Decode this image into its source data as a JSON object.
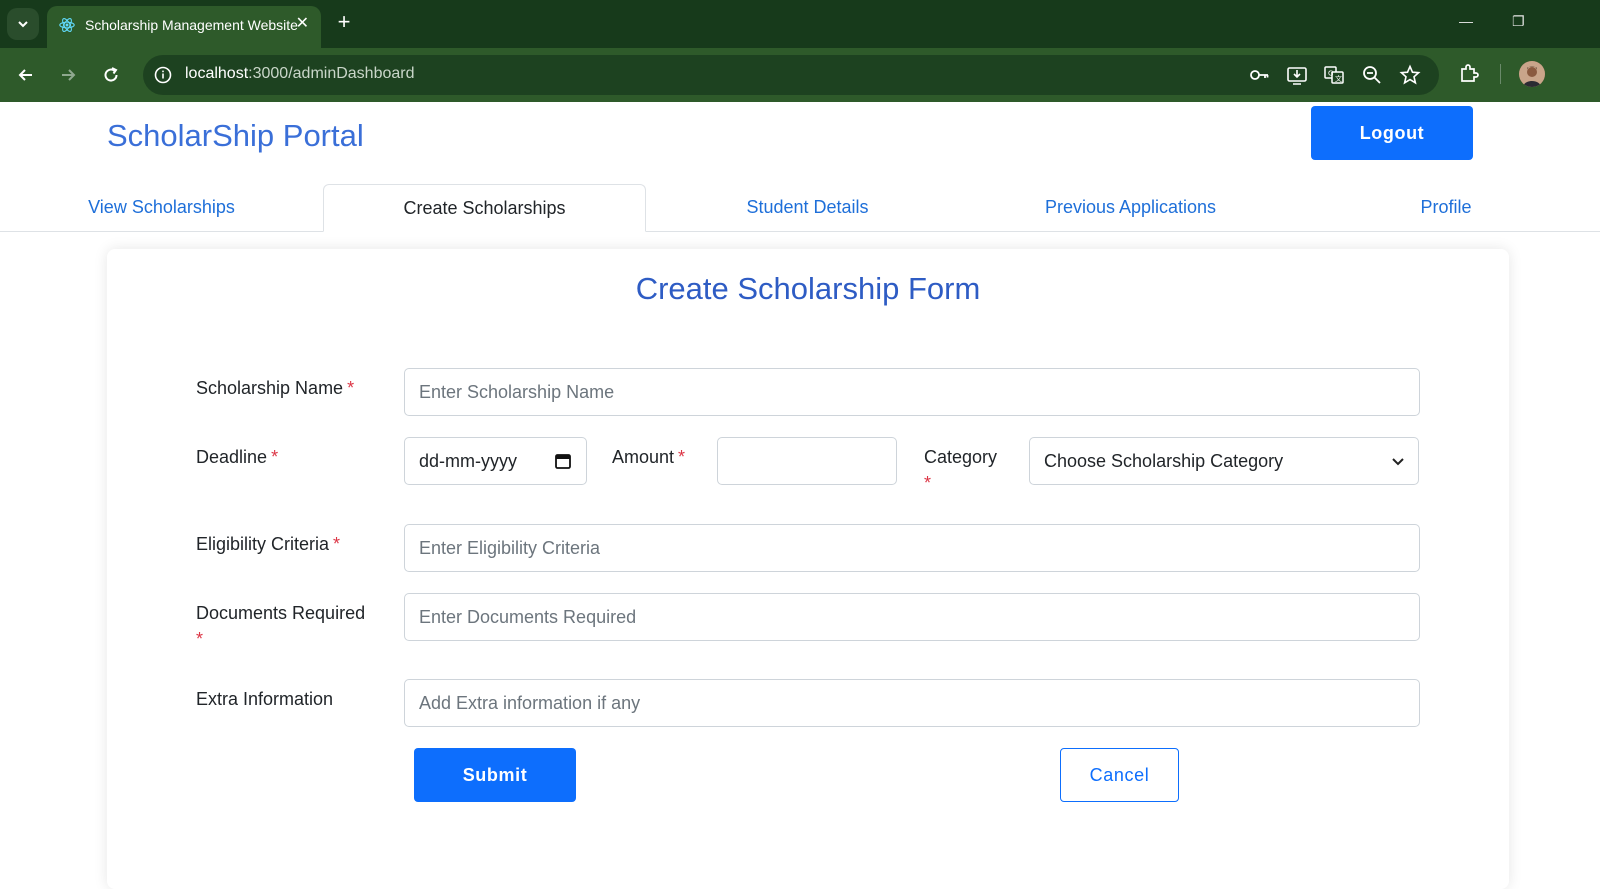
{
  "browser": {
    "tab_title": "Scholarship Management Website",
    "tab_close": "✕",
    "new_tab": "+",
    "url_host": "localhost",
    "url_path": ":3000/adminDashboard",
    "icons": [
      "tab-list-icon",
      "react-icon",
      "back-icon",
      "forward-icon",
      "reload-icon",
      "site-info-icon",
      "key-icon",
      "install-icon",
      "translate-icon",
      "zoom-icon",
      "star-icon",
      "extensions-icon",
      "avatar"
    ]
  },
  "header": {
    "brand": "ScholarShip Portal",
    "logout_label": "Logout"
  },
  "nav": {
    "tabs": [
      {
        "label": "View Scholarships",
        "active": false
      },
      {
        "label": "Create Scholarships",
        "active": true
      },
      {
        "label": "Student Details",
        "active": false
      },
      {
        "label": "Previous Applications",
        "active": false
      },
      {
        "label": "Profile",
        "active": false
      }
    ]
  },
  "form": {
    "title": "Create Scholarship Form",
    "name_label": "Scholarship Name",
    "name_placeholder": "Enter Scholarship Name",
    "deadline_label": "Deadline",
    "deadline_value": "dd-mm-yyyy",
    "amount_label": "Amount",
    "amount_value": "",
    "category_label": "Category",
    "category_value": "Choose Scholarship Category",
    "eligibility_label": "Eligibility Criteria",
    "eligibility_placeholder": "Enter Eligibility Criteria",
    "documents_label": "Documents Required",
    "documents_placeholder": "Enter Documents Required",
    "extra_label": "Extra Information",
    "extra_placeholder": "Add Extra information if any",
    "required_mark": "*",
    "submit_label": "Submit",
    "cancel_label": "Cancel"
  },
  "colors": {
    "chrome_dark": "#173a1b",
    "chrome_toolbar": "#2e5a2a",
    "brand_blue": "#3a6fd8",
    "primary": "#0d6efd",
    "required_red": "#dc3545"
  }
}
